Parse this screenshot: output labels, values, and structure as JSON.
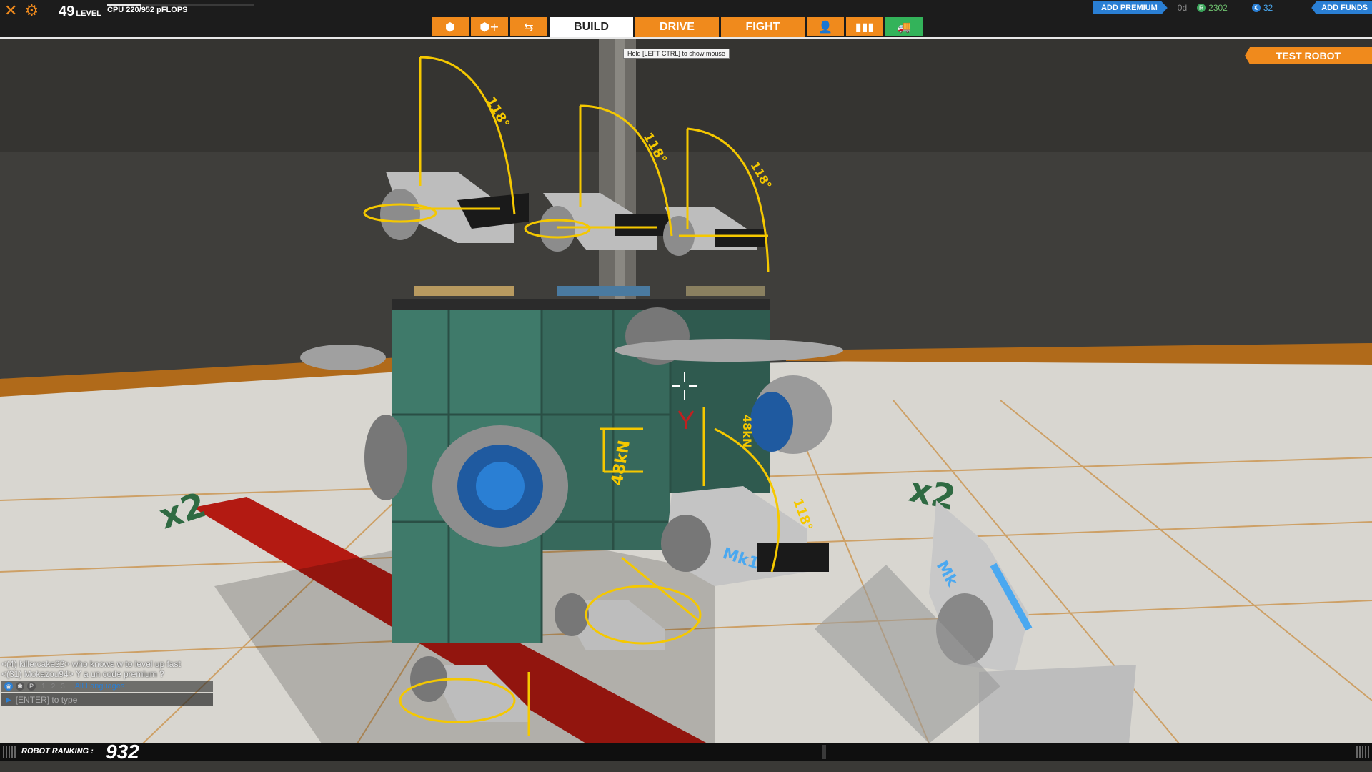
{
  "top_left": {
    "close_icon": "✕",
    "settings_icon": "⚙",
    "level_value": "49",
    "level_label": "LEVEL",
    "cpu_text": "CPU 220/952 pFLOPS",
    "cpu_used": 220,
    "cpu_max": 952
  },
  "tabs": {
    "icon_cube": "⬢",
    "icon_cube_plus": "⬢+",
    "icon_tools": "⇆",
    "build": "BUILD",
    "drive": "DRIVE",
    "fight": "FIGHT",
    "icon_profile": "👤",
    "icon_stats": "▮▮▮",
    "icon_garage": "🚚"
  },
  "tooltip": "Hold [LEFT CTRL] to show mouse",
  "top_right": {
    "add_premium": "ADD PREMIUM",
    "premium_time": "0d",
    "robits_icon": "R",
    "robits": "2302",
    "cosmetic_icon": "€",
    "cosmetic_credits": "32",
    "add_funds": "ADD FUNDS"
  },
  "test_robot": "TEST ROBOT",
  "scene": {
    "measure_angle_a": "118°",
    "measure_angle_b": "118°",
    "measure_angle_c": "118°",
    "measure_angle_d": "118°",
    "force_a": "48kN",
    "force_b": "48kN",
    "floor_x2_left": "x2",
    "floor_x2_right": "x2",
    "part_mk1": "Mk1",
    "part_mk": "Mk"
  },
  "chat": {
    "messages": [
      "<(4) killercake22> who knows w to level up fast",
      "<(31) Mokazou94> Y a un code premium ?"
    ],
    "tab1": "1",
    "tab2": "2",
    "tab3": "3",
    "lang": "All Languages",
    "input_placeholder": "[ENTER] to type"
  },
  "ranking": {
    "label": "ROBOT RANKING :",
    "value": "932"
  },
  "colors": {
    "accent_orange": "#f08a1c",
    "accent_blue": "#2a7fd4",
    "gizmo_yellow": "#f5c800"
  }
}
